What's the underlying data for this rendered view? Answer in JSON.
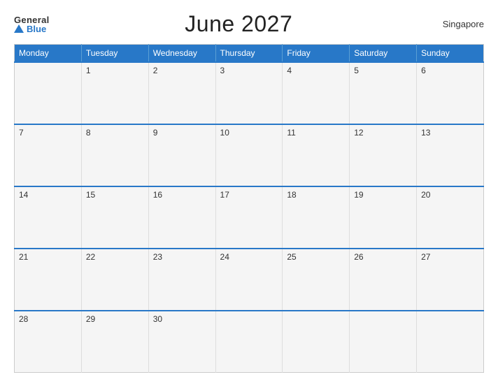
{
  "header": {
    "logo_general": "General",
    "logo_blue": "Blue",
    "title": "June 2027",
    "region": "Singapore"
  },
  "calendar": {
    "days": [
      "Monday",
      "Tuesday",
      "Wednesday",
      "Thursday",
      "Friday",
      "Saturday",
      "Sunday"
    ],
    "weeks": [
      [
        "",
        "1",
        "2",
        "3",
        "4",
        "5",
        "6"
      ],
      [
        "7",
        "8",
        "9",
        "10",
        "11",
        "12",
        "13"
      ],
      [
        "14",
        "15",
        "16",
        "17",
        "18",
        "19",
        "20"
      ],
      [
        "21",
        "22",
        "23",
        "24",
        "25",
        "26",
        "27"
      ],
      [
        "28",
        "29",
        "30",
        "",
        "",
        "",
        ""
      ]
    ]
  }
}
